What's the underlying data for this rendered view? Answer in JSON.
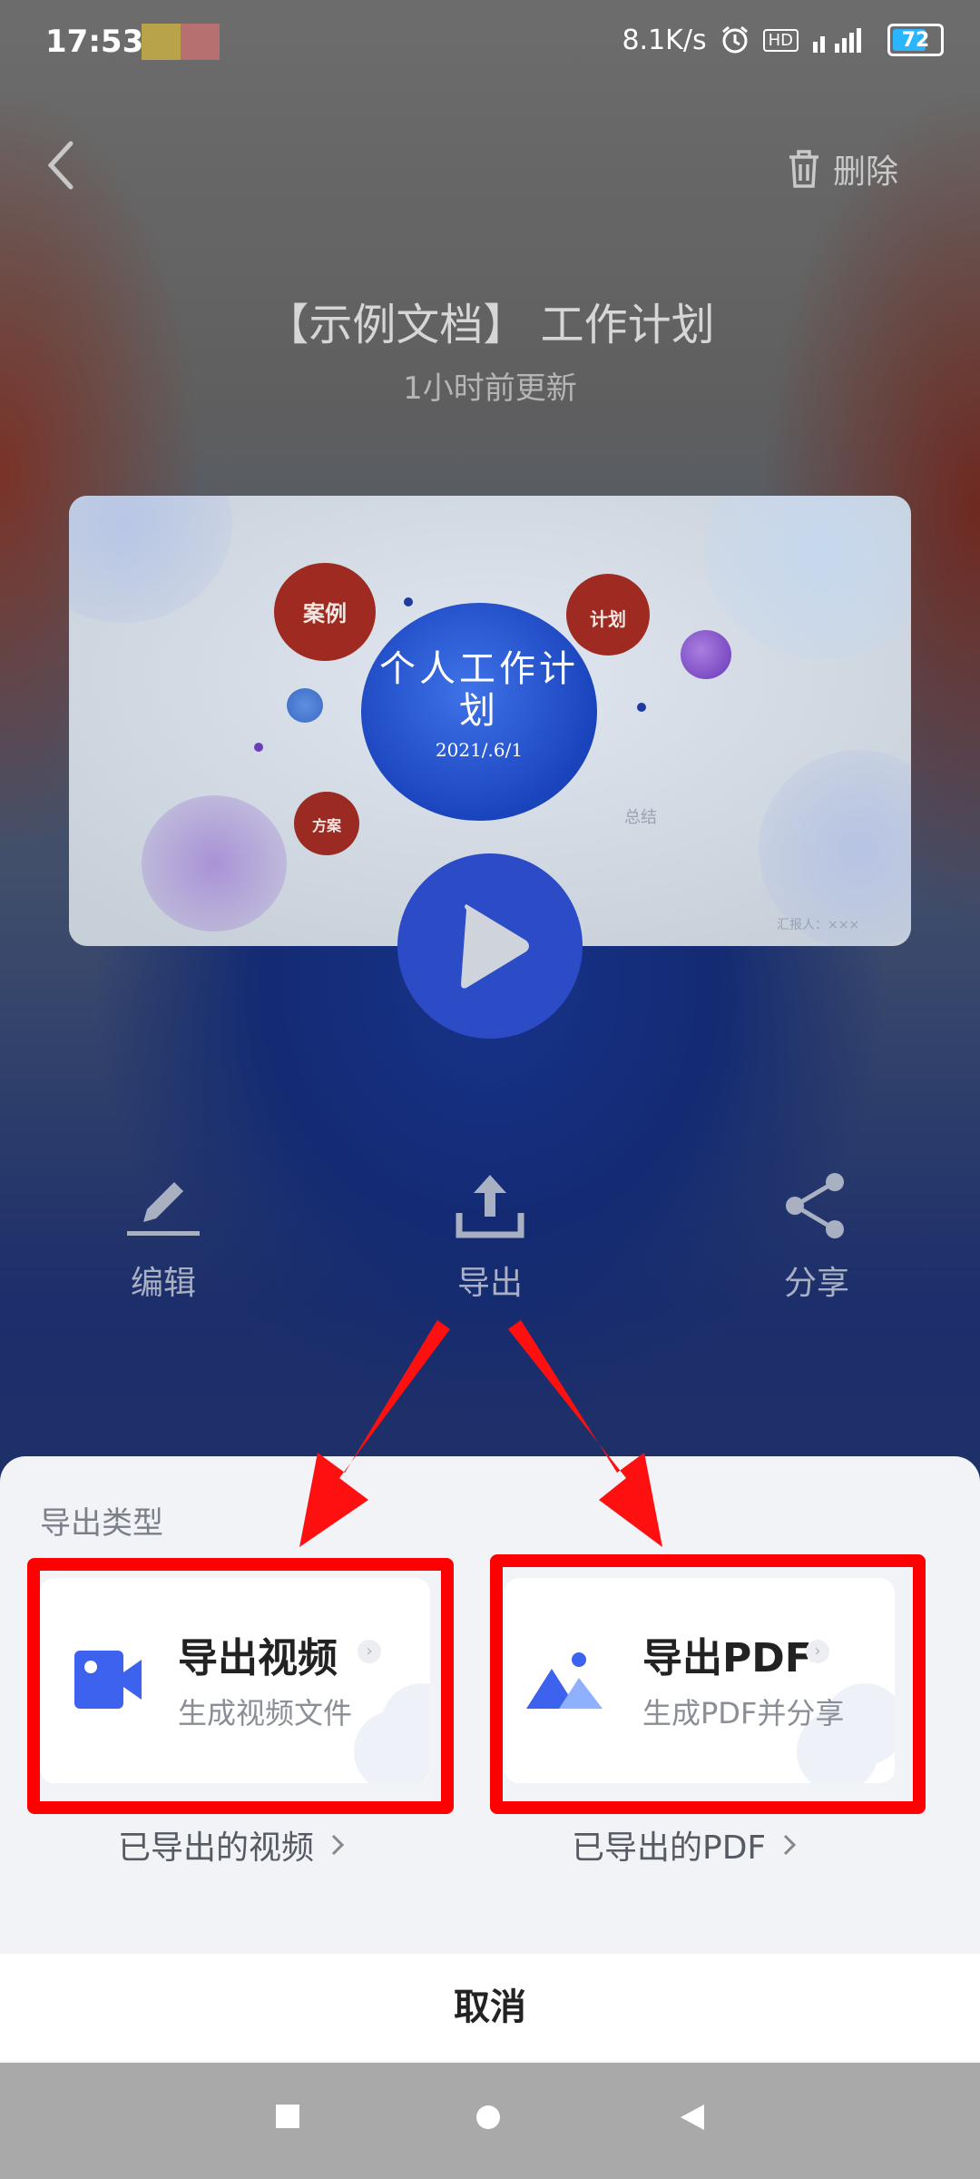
{
  "status_bar": {
    "time": "17:53",
    "net_speed": "8.1K/s",
    "hd_badge": "HD",
    "battery": "72"
  },
  "header": {
    "delete_label": "删除",
    "title": "【示例文档】 工作计划",
    "subtitle": "1小时前更新"
  },
  "preview": {
    "center_title": "个人工作计划",
    "date": "2021/.6/1",
    "bubble_case": "案例",
    "bubble_plan": "计划",
    "bubble_scheme": "方案",
    "summary": "总结",
    "reporter": "汇报人：×××"
  },
  "actions": [
    {
      "label": "编辑",
      "icon": "pencil-icon"
    },
    {
      "label": "导出",
      "icon": "upload-icon"
    },
    {
      "label": "分享",
      "icon": "share-icon"
    }
  ],
  "sheet": {
    "title": "导出类型",
    "options": [
      {
        "label": "导出视频",
        "sub": "生成视频文件",
        "icon": "video-camera-icon"
      },
      {
        "label": "导出PDF",
        "sub": "生成PDF并分享",
        "icon": "image-mountain-icon"
      }
    ],
    "exported_video": "已导出的视频",
    "exported_pdf": "已导出的PDF",
    "cancel": "取消"
  },
  "colors": {
    "accent_blue": "#3d63ee",
    "highlight_red": "#ff0000"
  }
}
